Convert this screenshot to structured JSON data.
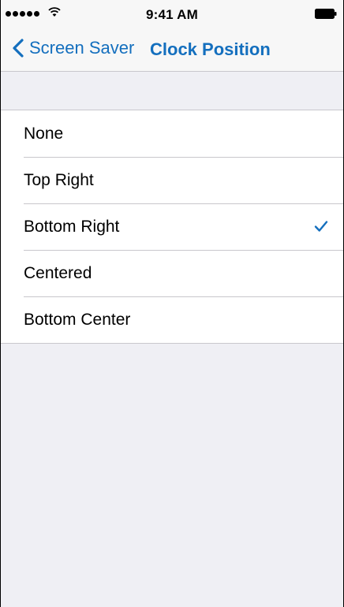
{
  "status_bar": {
    "time": "9:41 AM",
    "signal_icon": "cellular-signal-icon",
    "wifi_icon": "wifi-icon",
    "battery_icon": "battery-icon"
  },
  "nav": {
    "back_label": "Screen Saver",
    "title": "Clock Position"
  },
  "options": [
    {
      "label": "None",
      "selected": false
    },
    {
      "label": "Top Right",
      "selected": false
    },
    {
      "label": "Bottom Right",
      "selected": true
    },
    {
      "label": "Centered",
      "selected": false
    },
    {
      "label": "Bottom Center",
      "selected": false
    }
  ],
  "colors": {
    "accent": "#146fbe",
    "background": "#efeff4",
    "separator": "#c8c7cc"
  }
}
